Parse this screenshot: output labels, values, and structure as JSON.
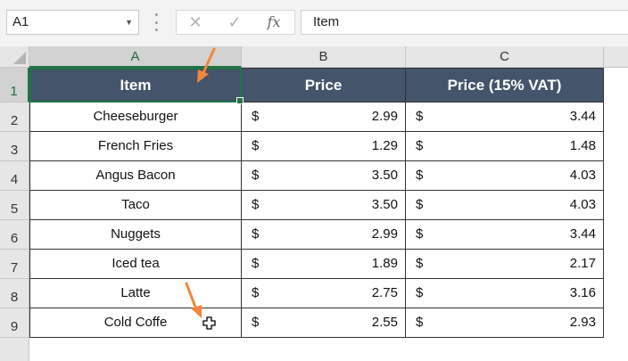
{
  "formula_bar": {
    "name_box": "A1",
    "formula": "Item",
    "fx_label": "fx",
    "cancel_glyph": "✕",
    "enter_glyph": "✓"
  },
  "columns": [
    "A",
    "B",
    "C"
  ],
  "rows": [
    "1",
    "2",
    "3",
    "4",
    "5",
    "6",
    "7",
    "8",
    "9"
  ],
  "table": {
    "headers": [
      "Item",
      "Price",
      "Price (15% VAT)"
    ],
    "currency": "$",
    "rows": [
      {
        "item": "Cheeseburger",
        "price": "2.99",
        "vat": "3.44"
      },
      {
        "item": "French Fries",
        "price": "1.29",
        "vat": "1.48"
      },
      {
        "item": "Angus Bacon",
        "price": "3.50",
        "vat": "4.03"
      },
      {
        "item": "Taco",
        "price": "3.50",
        "vat": "4.03"
      },
      {
        "item": "Nuggets",
        "price": "2.99",
        "vat": "3.44"
      },
      {
        "item": "Iced tea",
        "price": "1.89",
        "vat": "2.17"
      },
      {
        "item": "Latte",
        "price": "2.75",
        "vat": "3.16"
      },
      {
        "item": "Cold Coffe",
        "price": "2.55",
        "vat": "2.93"
      }
    ]
  },
  "colors": {
    "header_fill": "#44546a",
    "selection": "#217346",
    "arrow": "#f4863a"
  },
  "icons": [
    "select-all-triangle-icon",
    "cancel-icon",
    "enter-check-icon",
    "fx-icon",
    "dropdown-caret-icon",
    "cell-cursor-plus-icon",
    "annotation-arrow-icon"
  ]
}
